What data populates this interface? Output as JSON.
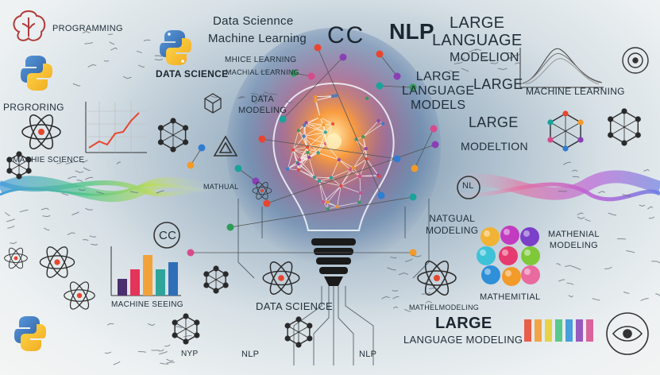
{
  "labels": {
    "programming_top": "Programming",
    "data_science_top": "Data Scienncе",
    "machine_learning_top": "Machine Learning",
    "cc_top": "CC",
    "nlp_top": "NLP",
    "large_top": "LARGE",
    "language_top": "LANGUAGE",
    "modelion_top": "MODELION",
    "mhice_learning": "MHICE LEARNING",
    "data_science_left": "DATA SCIENCE",
    "machial_learning": "MACHIAL LEARNING",
    "prgroring": "PRGRORING",
    "data_modeling": "DATA\nMODELING",
    "large_language_models": "LARGE\nLANGUAGE\nMODELS",
    "large_right": "LARGE",
    "large_right2": "LARGE",
    "modeltion": "MODELTION",
    "machine_learning_right": "MACHINE LEARNING",
    "machie_science": "MACHIE SCIENCE",
    "mathual": "MATHUAL",
    "nl": "NL",
    "natgual_modeling": "NATGUAL\nMODELING",
    "mathenial_modeling": "MATHENIAL\nMODELING",
    "cc_left": "CC",
    "machine_seeing": "MACHINE SEEING",
    "data_science_bottom": "DATA SCIENCE",
    "mathel_modeling": "MATHELMODELING",
    "mathemitial": "MATHEMITIAL",
    "large_bottom": "LARGE",
    "language_modeling": "LANGUAGE MODELING",
    "nyp": "NYP",
    "nlp_bottom1": "NLP",
    "nlp_bottom2": "NLP",
    "nlp_mid": "NLP"
  },
  "colors": {
    "python_blue": "#3a6fb0",
    "python_yellow": "#f4c43a",
    "glow": "#ff9a3c",
    "node_colors": [
      "#e8452f",
      "#f29a2a",
      "#2f9b57",
      "#8a3fb5",
      "#2f7dd1",
      "#d64b8c",
      "#1aa39a"
    ]
  },
  "chart_bars": [
    {
      "color": "#4b2e6e",
      "value": 0.35
    },
    {
      "color": "#e3345a",
      "value": 0.55
    },
    {
      "color": "#f2a23a",
      "value": 0.85
    },
    {
      "color": "#2fa49a",
      "value": 0.55
    },
    {
      "color": "#2e6fb8",
      "value": 0.7
    }
  ]
}
